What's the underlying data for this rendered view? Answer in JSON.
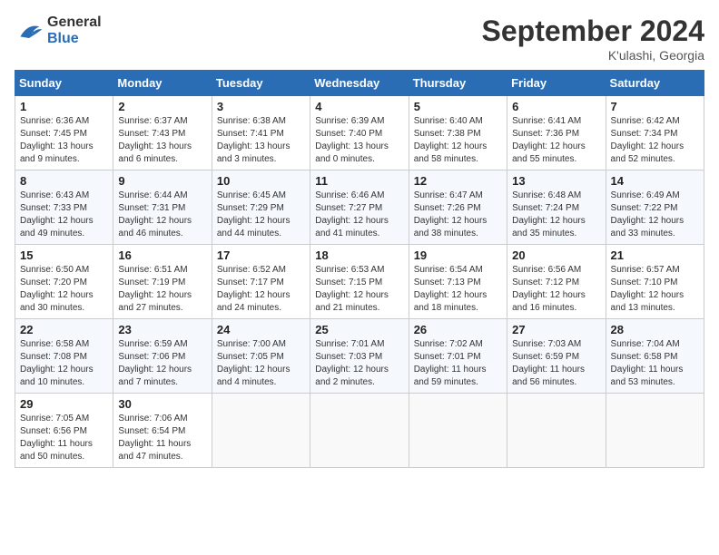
{
  "logo": {
    "line1": "General",
    "line2": "Blue"
  },
  "title": "September 2024",
  "subtitle": "K'ulashi, Georgia",
  "days_header": [
    "Sunday",
    "Monday",
    "Tuesday",
    "Wednesday",
    "Thursday",
    "Friday",
    "Saturday"
  ],
  "weeks": [
    [
      {
        "day": "1",
        "sunrise": "6:36 AM",
        "sunset": "7:45 PM",
        "daylight": "13 hours and 9 minutes."
      },
      {
        "day": "2",
        "sunrise": "6:37 AM",
        "sunset": "7:43 PM",
        "daylight": "13 hours and 6 minutes."
      },
      {
        "day": "3",
        "sunrise": "6:38 AM",
        "sunset": "7:41 PM",
        "daylight": "13 hours and 3 minutes."
      },
      {
        "day": "4",
        "sunrise": "6:39 AM",
        "sunset": "7:40 PM",
        "daylight": "13 hours and 0 minutes."
      },
      {
        "day": "5",
        "sunrise": "6:40 AM",
        "sunset": "7:38 PM",
        "daylight": "12 hours and 58 minutes."
      },
      {
        "day": "6",
        "sunrise": "6:41 AM",
        "sunset": "7:36 PM",
        "daylight": "12 hours and 55 minutes."
      },
      {
        "day": "7",
        "sunrise": "6:42 AM",
        "sunset": "7:34 PM",
        "daylight": "12 hours and 52 minutes."
      }
    ],
    [
      {
        "day": "8",
        "sunrise": "6:43 AM",
        "sunset": "7:33 PM",
        "daylight": "12 hours and 49 minutes."
      },
      {
        "day": "9",
        "sunrise": "6:44 AM",
        "sunset": "7:31 PM",
        "daylight": "12 hours and 46 minutes."
      },
      {
        "day": "10",
        "sunrise": "6:45 AM",
        "sunset": "7:29 PM",
        "daylight": "12 hours and 44 minutes."
      },
      {
        "day": "11",
        "sunrise": "6:46 AM",
        "sunset": "7:27 PM",
        "daylight": "12 hours and 41 minutes."
      },
      {
        "day": "12",
        "sunrise": "6:47 AM",
        "sunset": "7:26 PM",
        "daylight": "12 hours and 38 minutes."
      },
      {
        "day": "13",
        "sunrise": "6:48 AM",
        "sunset": "7:24 PM",
        "daylight": "12 hours and 35 minutes."
      },
      {
        "day": "14",
        "sunrise": "6:49 AM",
        "sunset": "7:22 PM",
        "daylight": "12 hours and 33 minutes."
      }
    ],
    [
      {
        "day": "15",
        "sunrise": "6:50 AM",
        "sunset": "7:20 PM",
        "daylight": "12 hours and 30 minutes."
      },
      {
        "day": "16",
        "sunrise": "6:51 AM",
        "sunset": "7:19 PM",
        "daylight": "12 hours and 27 minutes."
      },
      {
        "day": "17",
        "sunrise": "6:52 AM",
        "sunset": "7:17 PM",
        "daylight": "12 hours and 24 minutes."
      },
      {
        "day": "18",
        "sunrise": "6:53 AM",
        "sunset": "7:15 PM",
        "daylight": "12 hours and 21 minutes."
      },
      {
        "day": "19",
        "sunrise": "6:54 AM",
        "sunset": "7:13 PM",
        "daylight": "12 hours and 18 minutes."
      },
      {
        "day": "20",
        "sunrise": "6:56 AM",
        "sunset": "7:12 PM",
        "daylight": "12 hours and 16 minutes."
      },
      {
        "day": "21",
        "sunrise": "6:57 AM",
        "sunset": "7:10 PM",
        "daylight": "12 hours and 13 minutes."
      }
    ],
    [
      {
        "day": "22",
        "sunrise": "6:58 AM",
        "sunset": "7:08 PM",
        "daylight": "12 hours and 10 minutes."
      },
      {
        "day": "23",
        "sunrise": "6:59 AM",
        "sunset": "7:06 PM",
        "daylight": "12 hours and 7 minutes."
      },
      {
        "day": "24",
        "sunrise": "7:00 AM",
        "sunset": "7:05 PM",
        "daylight": "12 hours and 4 minutes."
      },
      {
        "day": "25",
        "sunrise": "7:01 AM",
        "sunset": "7:03 PM",
        "daylight": "12 hours and 2 minutes."
      },
      {
        "day": "26",
        "sunrise": "7:02 AM",
        "sunset": "7:01 PM",
        "daylight": "11 hours and 59 minutes."
      },
      {
        "day": "27",
        "sunrise": "7:03 AM",
        "sunset": "6:59 PM",
        "daylight": "11 hours and 56 minutes."
      },
      {
        "day": "28",
        "sunrise": "7:04 AM",
        "sunset": "6:58 PM",
        "daylight": "11 hours and 53 minutes."
      }
    ],
    [
      {
        "day": "29",
        "sunrise": "7:05 AM",
        "sunset": "6:56 PM",
        "daylight": "11 hours and 50 minutes."
      },
      {
        "day": "30",
        "sunrise": "7:06 AM",
        "sunset": "6:54 PM",
        "daylight": "11 hours and 47 minutes."
      },
      null,
      null,
      null,
      null,
      null
    ]
  ]
}
